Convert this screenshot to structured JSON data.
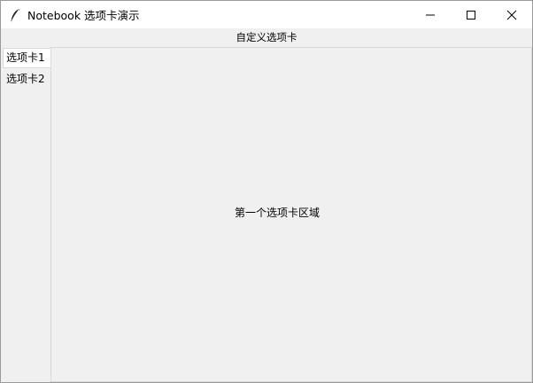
{
  "window": {
    "title": "Notebook 选项卡演示",
    "controls": {
      "minimize": "minimize-icon",
      "maximize": "maximize-icon",
      "close": "close-icon"
    }
  },
  "header": {
    "label": "自定义选项卡"
  },
  "tabs": [
    {
      "label": "选项卡1",
      "selected": true
    },
    {
      "label": "选项卡2",
      "selected": false
    }
  ],
  "panel": {
    "text": "第一个选项卡区域"
  },
  "colors": {
    "background": "#f0f0f0",
    "titlebar": "#ffffff",
    "border": "#d9d9d9"
  }
}
